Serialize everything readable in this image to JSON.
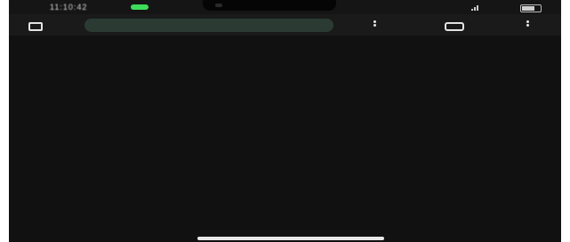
{
  "status_bar": {
    "time": "11:10:42",
    "center": "",
    "right": ""
  },
  "browser": {
    "address_prefix": "",
    "url": ""
  },
  "page_lines": []
}
